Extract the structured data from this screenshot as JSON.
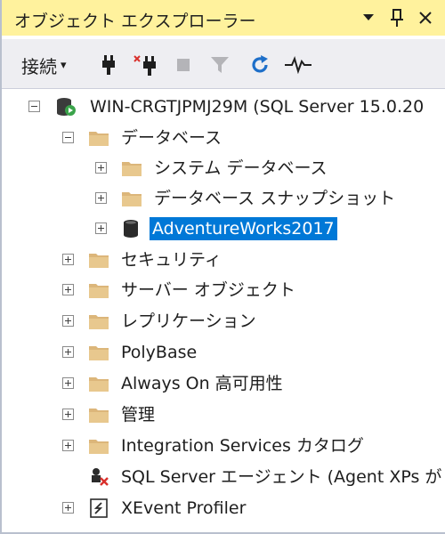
{
  "panel": {
    "title": "オブジェクト エクスプローラー",
    "title_buttons": {
      "dropdown": "▼",
      "pin": "ᅟ",
      "close": "✕"
    }
  },
  "toolbar": {
    "connect_label": "接続",
    "connect_arrow": "▾"
  },
  "tree": [
    {
      "label": "WIN-CRGTJPMJ29M (SQL Server 15.0.20",
      "icon": "server-running-icon",
      "expander": "minus",
      "selected": false
    },
    {
      "label": "データベース",
      "icon": "folder-icon",
      "expander": "minus",
      "selected": false
    },
    {
      "label": "システム データベース",
      "icon": "folder-icon",
      "expander": "plus",
      "selected": false
    },
    {
      "label": "データベース スナップショット",
      "icon": "folder-icon",
      "expander": "plus",
      "selected": false
    },
    {
      "label": "AdventureWorks2017",
      "icon": "database-icon",
      "expander": "plus",
      "selected": true
    },
    {
      "label": "セキュリティ",
      "icon": "folder-icon",
      "expander": "plus",
      "selected": false
    },
    {
      "label": "サーバー オブジェクト",
      "icon": "folder-icon",
      "expander": "plus",
      "selected": false
    },
    {
      "label": "レプリケーション",
      "icon": "folder-icon",
      "expander": "plus",
      "selected": false
    },
    {
      "label": "PolyBase",
      "icon": "folder-icon",
      "expander": "plus",
      "selected": false
    },
    {
      "label": "Always On 高可用性",
      "icon": "folder-icon",
      "expander": "plus",
      "selected": false
    },
    {
      "label": "管理",
      "icon": "folder-icon",
      "expander": "plus",
      "selected": false
    },
    {
      "label": "Integration Services カタログ",
      "icon": "folder-icon",
      "expander": "plus",
      "selected": false
    },
    {
      "label": "SQL Server エージェント (Agent XPs が",
      "icon": "sql-agent-stopped-icon",
      "expander": "none",
      "selected": false
    },
    {
      "label": "XEvent Profiler",
      "icon": "xevent-profiler-icon",
      "expander": "plus",
      "selected": false
    }
  ],
  "colors": {
    "title_bg": "#fff29d",
    "toolbar_bg": "#eeeef2",
    "selection": "#0078d7",
    "folder": "#dcb67a",
    "running": "#3aa34a",
    "stopped": "#d9302c"
  }
}
